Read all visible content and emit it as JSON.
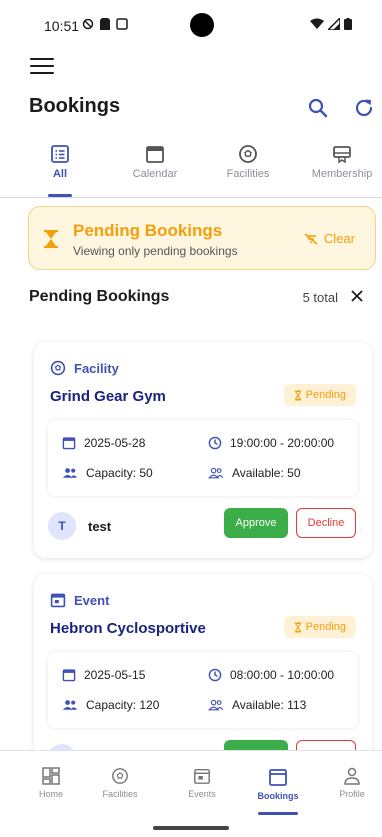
{
  "status_bar": {
    "time": "10:51"
  },
  "header": {
    "title": "Bookings"
  },
  "tabs": [
    {
      "label": "All",
      "icon": "list-icon",
      "active": true
    },
    {
      "label": "Calendar",
      "icon": "calendar-icon",
      "active": false
    },
    {
      "label": "Facilities",
      "icon": "soccer-ball-icon",
      "active": false
    },
    {
      "label": "Membership",
      "icon": "card-membership-icon",
      "active": false
    }
  ],
  "banner": {
    "title": "Pending Bookings",
    "subtitle": "Viewing only pending bookings",
    "clear_label": "Clear"
  },
  "section": {
    "title": "Pending Bookings",
    "count": "5 total"
  },
  "bookings": [
    {
      "type": "Facility",
      "name": "Grind Gear Gym",
      "status": "Pending",
      "date": "2025-05-28",
      "time": "19:00:00 - 20:00:00",
      "capacity": "Capacity: 50",
      "available": "Available: 50",
      "user_initial": "T",
      "user_name": "test",
      "approve_label": "Approve",
      "decline_label": "Decline"
    },
    {
      "type": "Event",
      "name": "Hebron Cyclosportive",
      "status": "Pending",
      "date": "2025-05-15",
      "time": "08:00:00 - 10:00:00",
      "capacity": "Capacity: 120",
      "available": "Available: 113"
    }
  ],
  "bottom_nav": [
    {
      "label": "Home",
      "icon": "dashboard-icon"
    },
    {
      "label": "Facilities",
      "icon": "soccer-ball-icon"
    },
    {
      "label": "Events",
      "icon": "event-icon"
    },
    {
      "label": "Bookings",
      "icon": "calendar-icon",
      "active": true
    },
    {
      "label": "Profile",
      "icon": "person-icon"
    }
  ],
  "colors": {
    "primary": "#3f51b5",
    "pending": "#f59e0b",
    "approve": "#3cae49",
    "decline": "#e53935"
  }
}
